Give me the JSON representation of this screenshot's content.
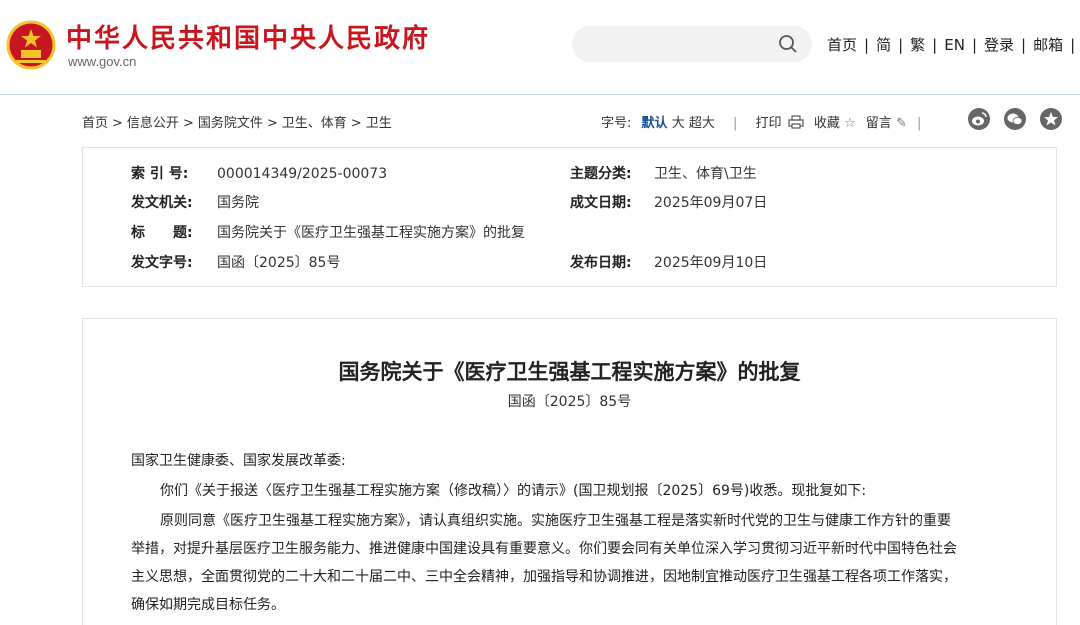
{
  "header": {
    "site_title": "中华人民共和国中央人民政府",
    "site_domain": "www.gov.cn",
    "search_placeholder": "",
    "nav": [
      "首页",
      "简",
      "繁",
      "EN",
      "登录",
      "邮箱"
    ]
  },
  "breadcrumb": [
    "首页",
    "信息公开",
    "国务院文件",
    "卫生、体育",
    "卫生"
  ],
  "tools": {
    "font_label": "字号:",
    "font_default": "默认",
    "font_big": "大",
    "font_bigger": "超大",
    "print": "打印",
    "favorite": "收藏",
    "comment": "留言"
  },
  "info": {
    "index_label": "索 引 号:",
    "index_value": "000014349/2025-00073",
    "topic_label": "主题分类:",
    "topic_value": "卫生、体育\\卫生",
    "issuer_label": "发文机关:",
    "issuer_value": "国务院",
    "created_label": "成文日期:",
    "created_value": "2025年09月07日",
    "title_label": "标　　题:",
    "title_value": "国务院关于《医疗卫生强基工程实施方案》的批复",
    "docno_label": "发文字号:",
    "docno_value": "国函〔2025〕85号",
    "published_label": "发布日期:",
    "published_value": "2025年09月10日"
  },
  "document": {
    "title": "国务院关于《医疗卫生强基工程实施方案》的批复",
    "number": "国函〔2025〕85号",
    "addressee": "国家卫生健康委、国家发展改革委:",
    "p1": "你们《关于报送〈医疗卫生强基工程实施方案（修改稿）〉的请示》(国卫规划报〔2025〕69号)收悉。现批复如下:",
    "p2_l1": "原则同意《医疗卫生强基工程实施方案》，请认真组织实施。实施医疗卫生强基工程是落实新时代党的卫生与健康工作方针的重要",
    "p2_l2": "举措，对提升基层医疗卫生服务能力、推进健康中国建设具有重要意义。你们要会同有关单位深入学习贯彻习近平新时代中国特色社会",
    "p2_l3": "主义思想，全面贯彻党的二十大和二十届二中、三中全会精神，加强指导和协调推进，因地制宜推动医疗卫生强基工程各项工作落实，",
    "p2_l4": "确保如期完成目标任务。"
  },
  "colors": {
    "brand_red": "#c8161e",
    "emblem_gold": "#f4c430",
    "link_blue": "#1b4f93"
  },
  "icons": [
    "national-emblem-icon",
    "search-icon",
    "printer-icon",
    "star-icon",
    "pencil-icon",
    "weibo-icon",
    "wechat-icon",
    "qzone-icon"
  ]
}
